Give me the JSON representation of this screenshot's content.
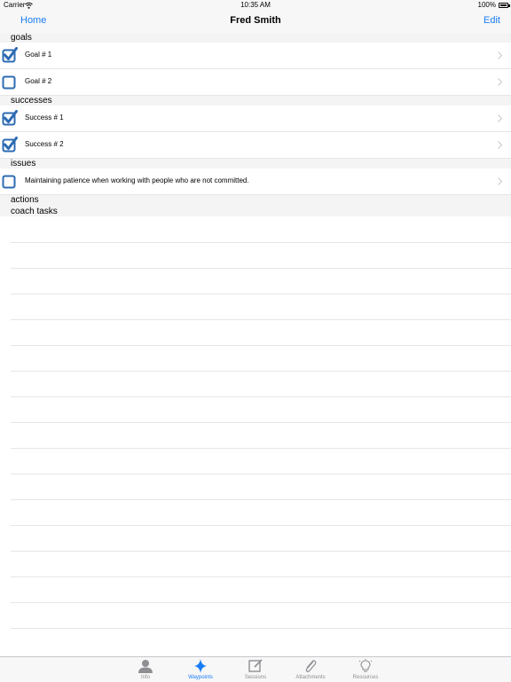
{
  "status_bar": {
    "carrier": "Carrier",
    "time": "10:35 AM",
    "battery": "100%"
  },
  "nav": {
    "back_label": "Home",
    "title": "Fred Smith",
    "edit_label": "Edit"
  },
  "sections": {
    "goals": {
      "header": "goals",
      "items": [
        {
          "label": "Goal # 1",
          "checked": true
        },
        {
          "label": "Goal # 2",
          "checked": false
        }
      ]
    },
    "successes": {
      "header": "successes",
      "items": [
        {
          "label": "Success # 1",
          "checked": true
        },
        {
          "label": "Success # 2",
          "checked": true
        }
      ]
    },
    "issues": {
      "header": "issues",
      "items": [
        {
          "label": "Maintaining patience when working with people who are not committed.",
          "checked": false
        }
      ]
    },
    "actions": {
      "header": "actions"
    },
    "coach_tasks": {
      "header": "coach tasks"
    }
  },
  "tabs": [
    {
      "label": "Info",
      "icon": "person-icon",
      "active": false
    },
    {
      "label": "Waypoints",
      "icon": "star-icon",
      "active": true
    },
    {
      "label": "Sessions",
      "icon": "compose-icon",
      "active": false
    },
    {
      "label": "Attachments",
      "icon": "paperclip-icon",
      "active": false
    },
    {
      "label": "Resources",
      "icon": "lightbulb-icon",
      "active": false
    }
  ],
  "colors": {
    "accent": "#1a7cf5",
    "checkbox": "#2d6bb3",
    "tab_inactive": "#8e8e93"
  }
}
